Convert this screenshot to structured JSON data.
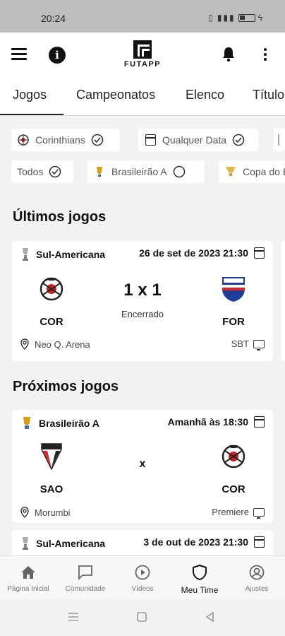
{
  "status_bar": {
    "time": "20:24"
  },
  "app": {
    "name": "FUTAPP"
  },
  "tabs": [
    {
      "label": "Jogos"
    },
    {
      "label": "Campeonatos"
    },
    {
      "label": "Elenco"
    },
    {
      "label": "Títulos"
    }
  ],
  "filters": {
    "row1": [
      {
        "label": "Corinthians",
        "icon": "corinthians-crest-icon"
      },
      {
        "label": "Qualquer Data",
        "icon": "calendar-icon"
      }
    ],
    "row2": [
      {
        "label": "Todos"
      },
      {
        "label": "Brasileirão A",
        "icon": "brasileirao-trophy-icon"
      },
      {
        "label": "Copa do Brasil",
        "icon": "copa-trophy-icon"
      }
    ]
  },
  "sections": {
    "last": "Últimos jogos",
    "next": "Próximos jogos"
  },
  "last_games": [
    {
      "league": "Sul-Americana",
      "datetime": "26 de set de 2023 21:30",
      "home": "COR",
      "away": "FOR",
      "score": "1 x 1",
      "status": "Encerrado",
      "venue": "Neo Q. Arena",
      "broadcast": "SBT"
    }
  ],
  "next_games": [
    {
      "league": "Brasileirão A",
      "datetime": "Amanhã às 18:30",
      "home": "SAO",
      "away": "COR",
      "versus": "x",
      "venue": "Morumbi",
      "broadcast": "Premiere"
    },
    {
      "league": "Sul-Americana",
      "datetime": "3 de out de 2023 21:30"
    }
  ],
  "bottom_nav": [
    {
      "label": "Página Inicial",
      "icon": "home-icon"
    },
    {
      "label": "Comunidade",
      "icon": "chat-icon"
    },
    {
      "label": "Vídeos",
      "icon": "play-icon"
    },
    {
      "label": "Meu Time",
      "icon": "shield-icon"
    },
    {
      "label": "Ajustes",
      "icon": "user-settings-icon"
    }
  ],
  "colors": {
    "accent": "#111111",
    "status_bar": "#bdbdbd",
    "background": "#f2f2f2"
  }
}
